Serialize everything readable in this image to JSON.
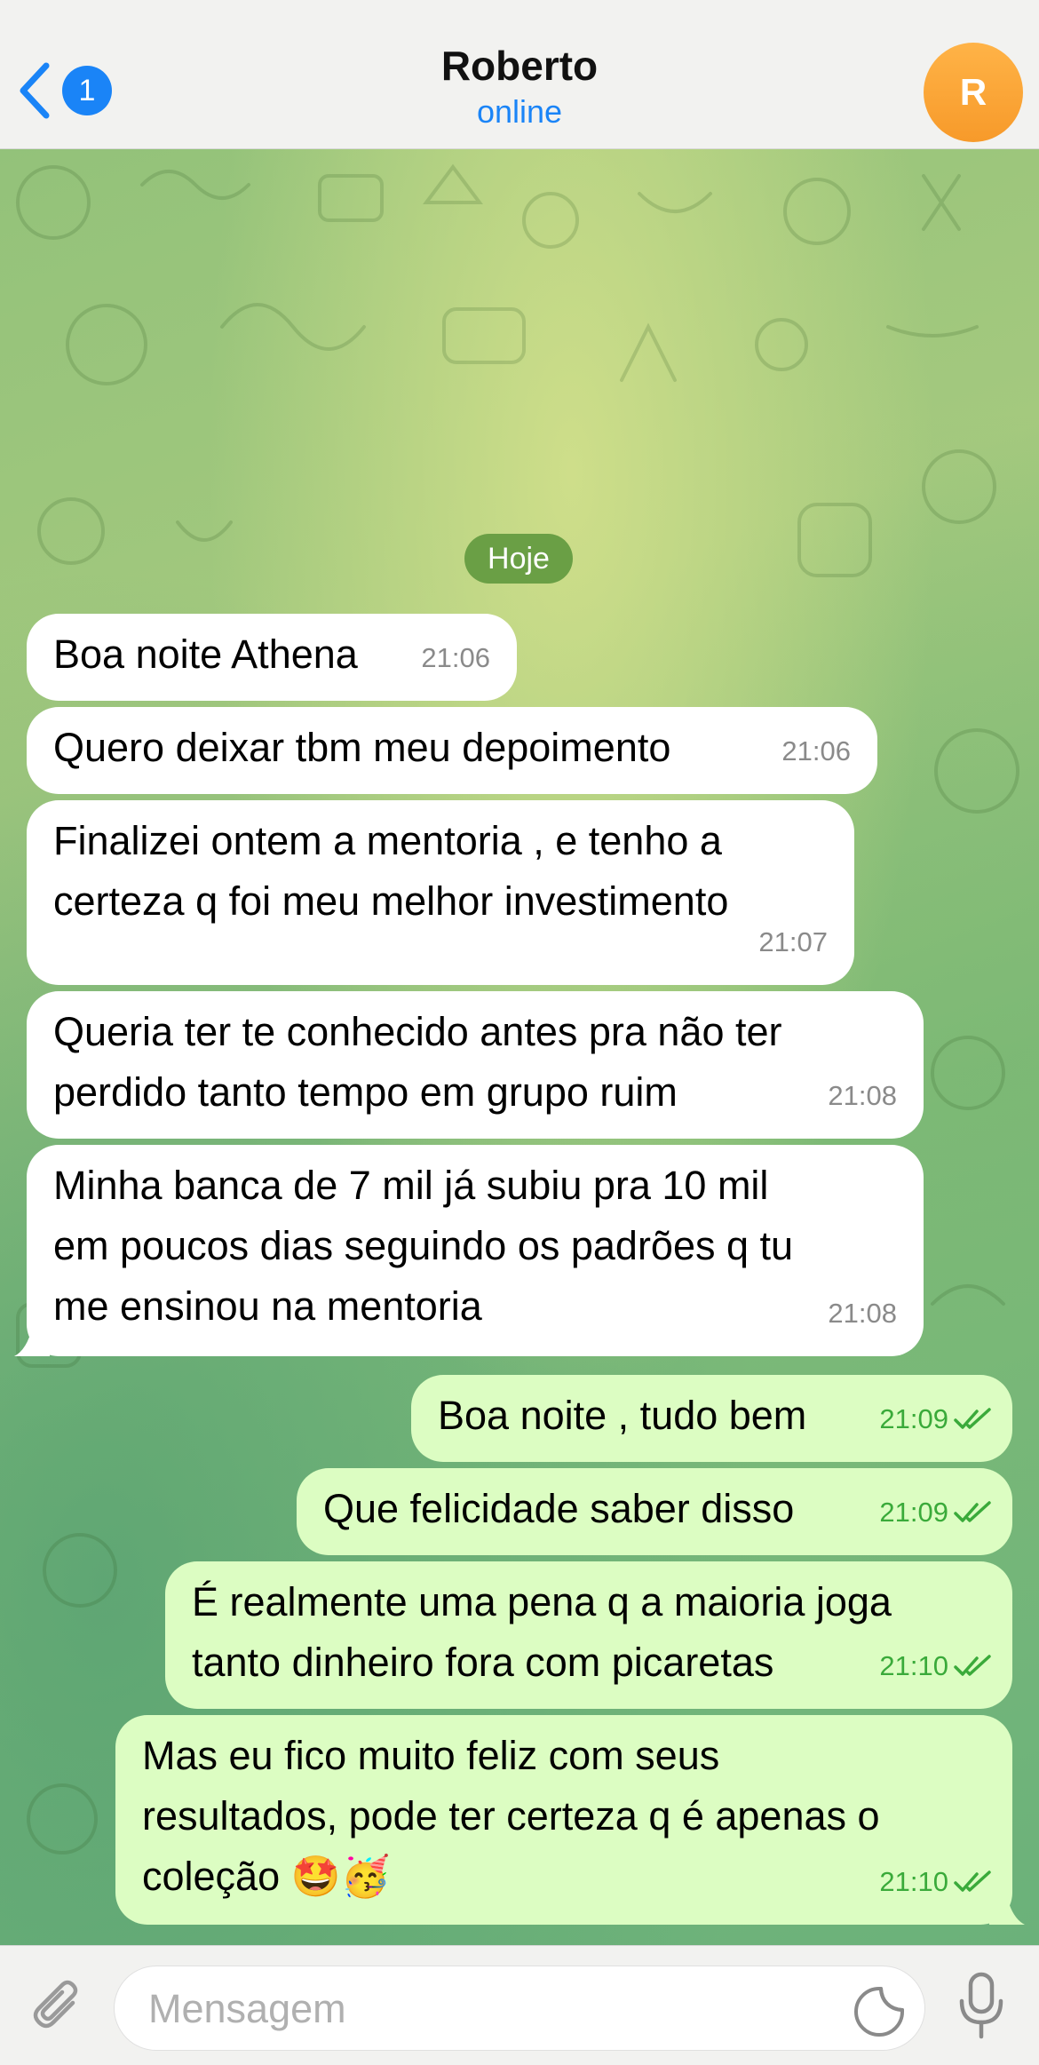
{
  "header": {
    "back_badge": "1",
    "contact_name": "Roberto",
    "contact_status": "online",
    "avatar_initial": "R",
    "accent_color": "#1a84f7",
    "avatar_color": "#f79a2a"
  },
  "chat": {
    "date_label": "Hoje",
    "messages": [
      {
        "direction": "in",
        "text": "Boa noite Athena",
        "time": "21:06"
      },
      {
        "direction": "in",
        "text": "Quero deixar tbm meu depoimento",
        "time": "21:06"
      },
      {
        "direction": "in",
        "text": "Finalizei ontem a mentoria , e tenho a\ncerteza q foi meu melhor investimento",
        "time": "21:07"
      },
      {
        "direction": "in",
        "text": "Queria ter te conhecido antes pra não ter\nperdido tanto tempo em grupo ruim",
        "time": "21:08"
      },
      {
        "direction": "in",
        "text": "Minha banca de 7 mil já subiu pra 10 mil\nem poucos dias seguindo os padrões q tu\nme ensinou na mentoria",
        "time": "21:08"
      },
      {
        "direction": "out",
        "text": "Boa noite , tudo bem",
        "time": "21:09",
        "status": "read"
      },
      {
        "direction": "out",
        "text": "Que felicidade saber disso",
        "time": "21:09",
        "status": "read"
      },
      {
        "direction": "out",
        "text": "É realmente uma pena q a maioria joga\ntanto dinheiro fora com picaretas",
        "time": "21:10",
        "status": "read"
      },
      {
        "direction": "out",
        "text": "Mas eu fico muito feliz com seus\nresultados, pode ter certeza q é apenas o\ncoleção 🤩🥳",
        "time": "21:10",
        "status": "read"
      }
    ],
    "incoming_bubble_color": "#ffffff",
    "outgoing_bubble_color": "#dcfdc2",
    "read_check_color": "#3aaa3a"
  },
  "input_bar": {
    "placeholder": "Mensagem",
    "value": ""
  },
  "icons": {
    "back": "chevron-left-icon",
    "attach": "paperclip-icon",
    "sticker": "sticker-icon",
    "mic": "microphone-icon",
    "read": "double-check-icon"
  }
}
